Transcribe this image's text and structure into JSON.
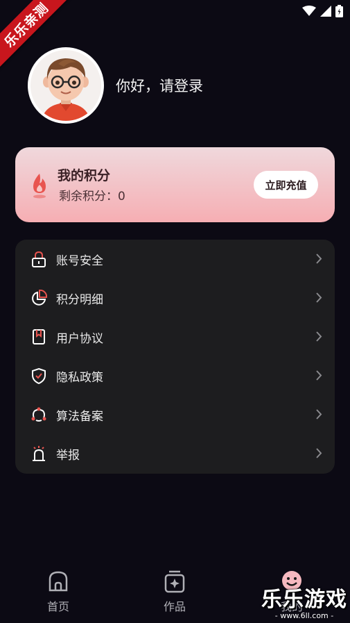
{
  "watermark": {
    "ribbon_text": "乐乐亲测",
    "brand_text": "乐乐游戏",
    "brand_url": "- www.6ll.com -"
  },
  "profile": {
    "greeting": "你好，请登录"
  },
  "points": {
    "title": "我的积分",
    "remaining": "剩余积分：0",
    "recharge_label": "立即充值"
  },
  "menu": {
    "items": [
      {
        "label": "账号安全",
        "icon": "lock-icon"
      },
      {
        "label": "积分明细",
        "icon": "pie-chart-icon"
      },
      {
        "label": "用户协议",
        "icon": "bookmark-document-icon"
      },
      {
        "label": "隐私政策",
        "icon": "shield-check-icon"
      },
      {
        "label": "算法备案",
        "icon": "algorithm-nodes-icon"
      },
      {
        "label": "举报",
        "icon": "alarm-siren-icon"
      }
    ]
  },
  "nav": {
    "items": [
      {
        "label": "首页",
        "icon": "home-icon"
      },
      {
        "label": "作品",
        "icon": "works-icon"
      },
      {
        "label": "我的",
        "icon": "smiley-icon"
      }
    ]
  },
  "colors": {
    "accent": "#e8544f",
    "background": "#0c0a14",
    "card": "#1d1d1f"
  }
}
